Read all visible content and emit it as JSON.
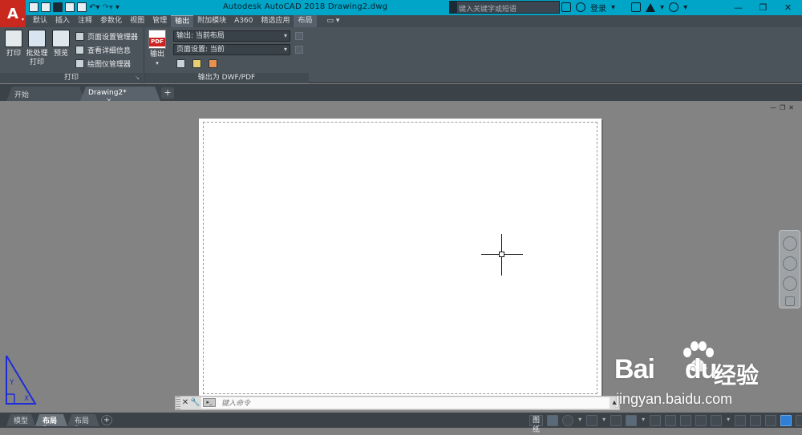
{
  "app": {
    "window_title": "Autodesk AutoCAD 2018    Drawing2.dwg",
    "app_button_letter": "A",
    "search_placeholder": "键入关键字或短语",
    "login_label": "登录"
  },
  "ribbon_tabs": [
    "默认",
    "插入",
    "注释",
    "参数化",
    "视图",
    "管理",
    "输出",
    "附加模块",
    "A360",
    "精选应用",
    "布局"
  ],
  "active_ribbon_tab": "输出",
  "ribbon": {
    "print_panel": {
      "title": "打印",
      "plot_label": "打印",
      "batch_plot_label_1": "批处理",
      "batch_plot_label_2": "打印",
      "preview_label": "预览",
      "page_setup_manager": "页面设置管理器",
      "view_details": "查看详细信息",
      "plotter_manager": "绘图仪管理器"
    },
    "export_panel": {
      "title": "输出为 DWF/PDF",
      "export_label": "输出",
      "pdf_badge": "PDF",
      "export_dropdown": "输出: 当前布局",
      "page_setup_dropdown": "页面设置: 当前"
    }
  },
  "file_tabs": [
    {
      "label": "开始"
    },
    {
      "label": "Drawing2*",
      "close": "×"
    }
  ],
  "add_tab_symbol": "+",
  "viewport_controls": [
    "—",
    "❐",
    "✕"
  ],
  "ucs": {
    "x_label": "X",
    "y_label": "Y"
  },
  "command_line": {
    "placeholder": "键入命令",
    "close_symbol": "✕",
    "prompt_icon": "▸_"
  },
  "layout_tabs": [
    "模型",
    "布局1",
    "布局2"
  ],
  "active_layout_tab": "布局1",
  "add_layout_symbol": "+",
  "status_bar": {
    "paper_label": "图纸"
  },
  "watermark": {
    "brand": "Bai",
    "brand_end": "du",
    "chinese": "经验",
    "url": "jingyan.baidu.com"
  },
  "colors": {
    "title_bar": "#00a5c8",
    "app_button": "#c8281e",
    "ribbon_bg": "#4b535b",
    "canvas_bg": "#838383",
    "sheet": "#ffffff"
  }
}
